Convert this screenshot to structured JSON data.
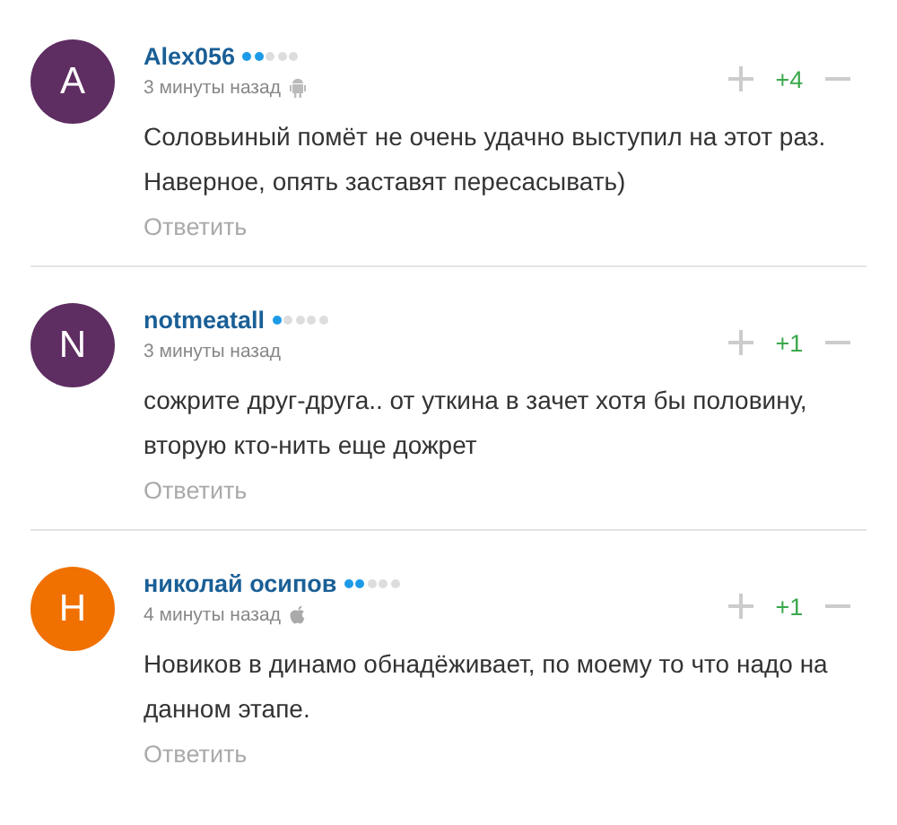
{
  "comments": [
    {
      "avatar": {
        "letter": "A",
        "color": "#5e2d62"
      },
      "author": "Alex056",
      "stars": 2,
      "time": "3 минуты назад",
      "kind": "android",
      "score": "+4",
      "text": "Соловьиный помёт не очень удачно выступил на этот раз. Наверное, опять заставят пересасывать)",
      "reply": "Ответить"
    },
    {
      "avatar": {
        "letter": "N",
        "color": "#5e2d62"
      },
      "author": "notmeatall",
      "stars": 1,
      "time": "3 минуты назад",
      "score": "+1",
      "text": "сожрите друг-друга.. от уткина в зачет хотя бы половину, вторую кто-нить еще дожрет",
      "reply": "Ответить"
    },
    {
      "avatar": {
        "letter": "Н",
        "color": "#f07000"
      },
      "author": "николай осипов",
      "stars": 2,
      "time": "4 минуты назад",
      "kind": "apple",
      "score": "+1",
      "text": "Новиков в динамо обнадёживает, по моему то что надо на данном этапе.",
      "reply": "Ответить"
    }
  ]
}
